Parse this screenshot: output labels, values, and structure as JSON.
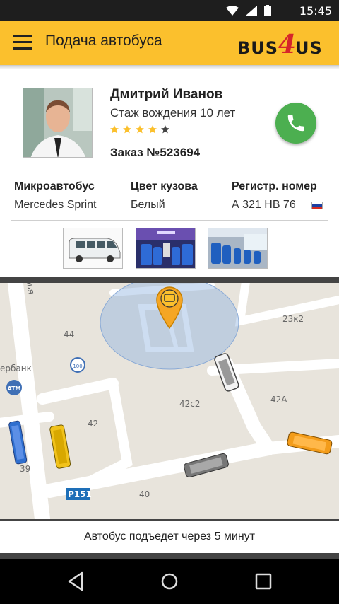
{
  "status_bar": {
    "time": "15:45",
    "icons": [
      "wifi-icon",
      "signal-icon",
      "battery-icon"
    ]
  },
  "app_bar": {
    "title": "Подача автобуса",
    "logo": {
      "part1": "BUS",
      "part2": "4",
      "part3": "US"
    }
  },
  "driver": {
    "name": "Дмитрий Иванов",
    "experience": "Стаж вождения 10 лет",
    "rating": 4,
    "rating_max": 5,
    "order": "Заказ №523694"
  },
  "vehicle": {
    "headers": [
      "Микроавтобус",
      "Цвет кузова",
      "Регистр. номер"
    ],
    "values": [
      "Mercedes Sprint",
      "Белый",
      "А 321 НВ 76"
    ]
  },
  "map": {
    "labels": [
      "44",
      "23к2",
      "42с2",
      "42А",
      "42",
      "39",
      "40",
      "P151",
      "ATM",
      "ербанк",
      "рья"
    ]
  },
  "eta": {
    "text": "Автобус подъедет через 5 минут"
  },
  "colors": {
    "accent": "#fbc02d",
    "call": "#4caf50",
    "star": "#fbc02d"
  }
}
